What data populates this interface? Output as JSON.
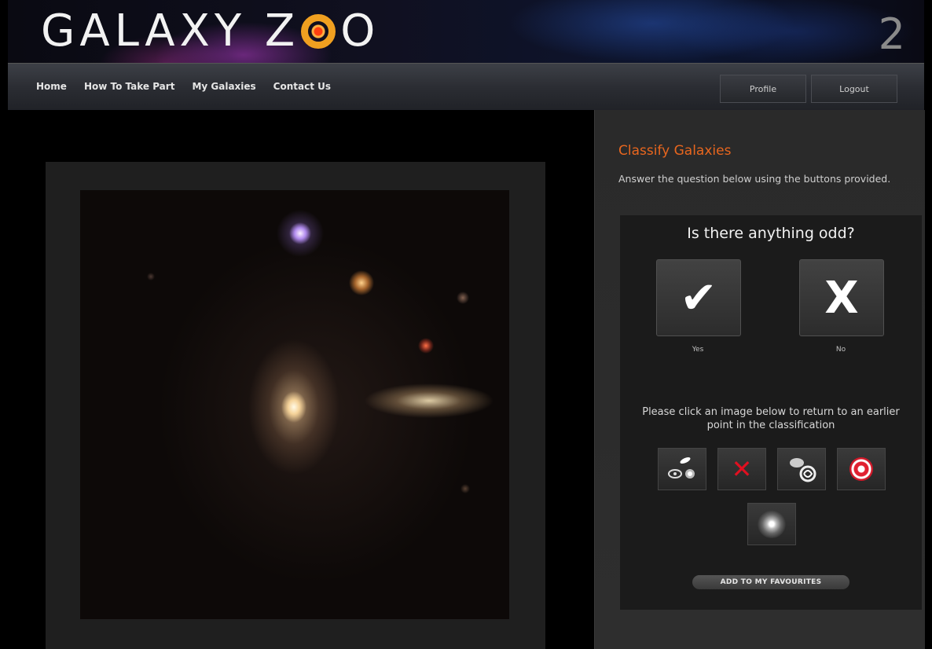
{
  "header": {
    "logo_text_left": "GALAXY Z",
    "logo_text_right": "O",
    "version": "2"
  },
  "nav": {
    "links": [
      "Home",
      "How To Take Part",
      "My Galaxies",
      "Contact Us"
    ],
    "profile_label": "Profile",
    "logout_label": "Logout"
  },
  "panel": {
    "title": "Classify Galaxies",
    "description": "Answer the question below using the buttons provided.",
    "question": "Is there anything odd?",
    "answers": [
      {
        "symbol": "✔",
        "label": "Yes"
      },
      {
        "symbol": "X",
        "label": "No"
      }
    ],
    "history_text": "Please click an image below to return to an earlier point in the classification",
    "history_icons": [
      "smooth-galaxy-icon",
      "not-edge-on-icon",
      "no-bar-spiral-icon",
      "spiral-arms-icon",
      "spiral-galaxy-icon"
    ],
    "favourites_label": "ADD TO MY FAVOURITES"
  },
  "colors": {
    "accent": "#e8661e",
    "background": "#000000",
    "panel": "#2a2a2a"
  }
}
